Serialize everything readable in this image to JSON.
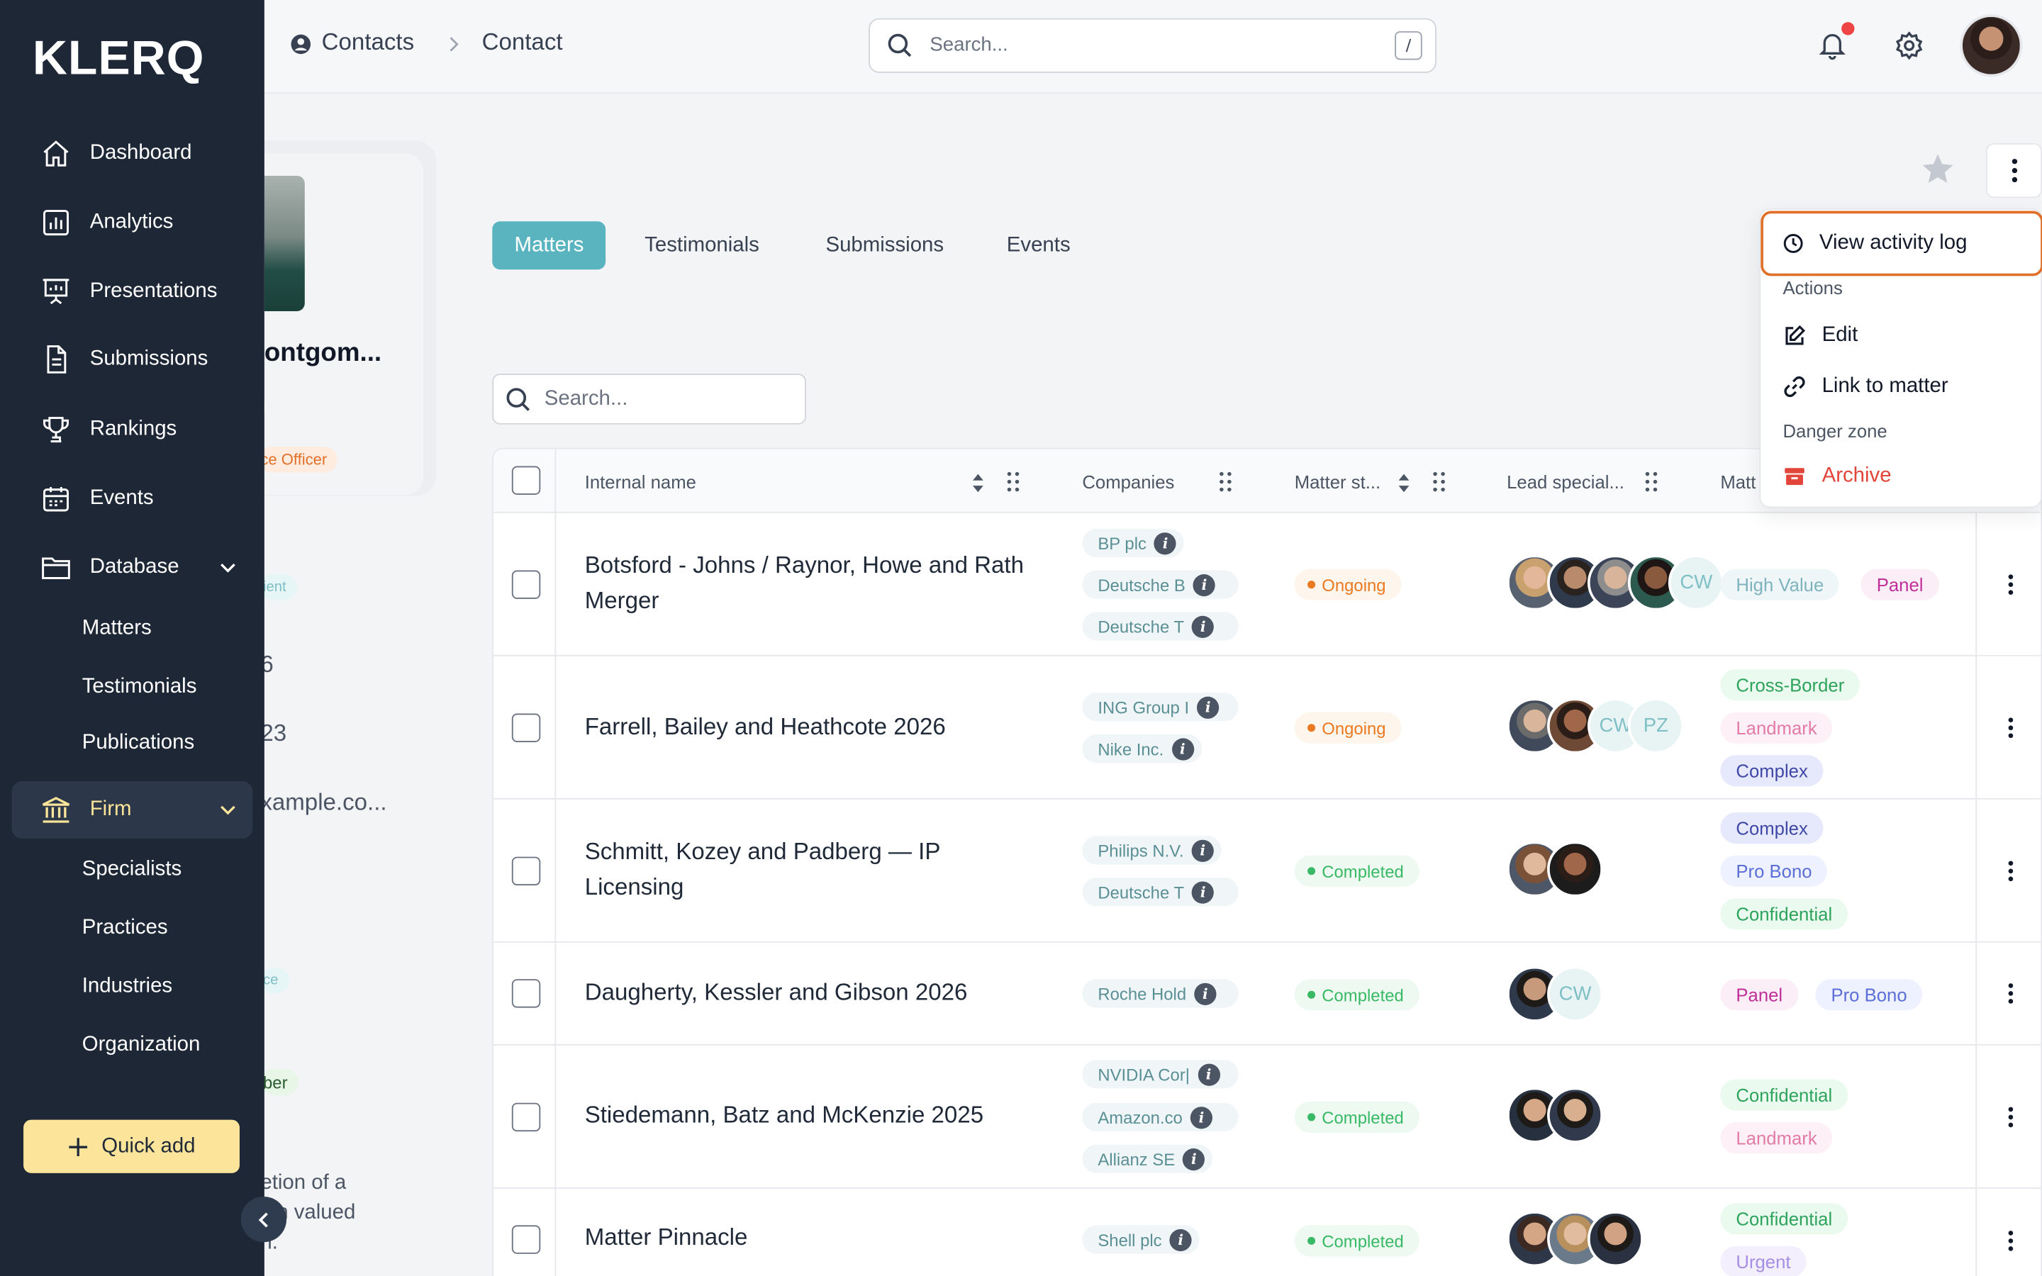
{
  "app": {
    "logo": "KLERQ"
  },
  "sidebar": {
    "items": [
      {
        "label": "Dashboard",
        "icon": "home-icon"
      },
      {
        "label": "Analytics",
        "icon": "analytics-icon"
      },
      {
        "label": "Presentations",
        "icon": "presentation-icon"
      },
      {
        "label": "Submissions",
        "icon": "document-icon"
      },
      {
        "label": "Rankings",
        "icon": "trophy-icon"
      },
      {
        "label": "Events",
        "icon": "calendar-icon"
      },
      {
        "label": "Database",
        "icon": "folder-icon"
      }
    ],
    "database_sub": [
      "Matters",
      "Testimonials",
      "Publications"
    ],
    "firm": {
      "label": "Firm",
      "icon": "bank-icon"
    },
    "firm_sub": [
      "Specialists",
      "Practices",
      "Industries",
      "Organization"
    ],
    "quick_add": "Quick add"
  },
  "header": {
    "breadcrumb": [
      "Contacts",
      "Contact"
    ],
    "search_placeholder": "Search...",
    "search_shortcut": "/"
  },
  "profile": {
    "name_fragment": "ontgom...",
    "role_fragment": "ce Officer",
    "bg_fragments": [
      "ient",
      "6",
      "23",
      "xample.co...",
      "ce",
      "ber",
      "etion of a",
      "ion valued",
      "n."
    ]
  },
  "tabs": [
    "Matters",
    "Testimonials",
    "Submissions",
    "Events"
  ],
  "table_search_placeholder": "Search...",
  "table": {
    "columns": [
      "Internal name",
      "Companies",
      "Matter st...",
      "Lead special...",
      "Matt"
    ],
    "rows": [
      {
        "name": "Botsford - Johns / Raynor, Howe and Rath Merger",
        "companies": [
          "BP plc",
          "Deutsche B",
          "Deutsche T"
        ],
        "status": "Ongoing",
        "avatars": [
          "photo",
          "photo",
          "photo",
          "photo",
          "CW"
        ],
        "tags": [
          "High Value",
          "Panel"
        ]
      },
      {
        "name": "Farrell, Bailey and Heathcote 2026",
        "companies": [
          "ING Group I",
          "Nike Inc."
        ],
        "status": "Ongoing",
        "avatars": [
          "photo",
          "photo",
          "CW",
          "PZ"
        ],
        "tags": [
          "Cross-Border",
          "Landmark",
          "Complex"
        ]
      },
      {
        "name": "Schmitt, Kozey and Padberg — IP Licensing",
        "companies": [
          "Philips N.V.",
          "Deutsche T"
        ],
        "status": "Completed",
        "avatars": [
          "photo",
          "photo"
        ],
        "tags": [
          "Complex",
          "Pro Bono",
          "Confidential"
        ]
      },
      {
        "name": "Daugherty, Kessler and Gibson 2026",
        "companies": [
          "Roche Hold"
        ],
        "status": "Completed",
        "avatars": [
          "photo",
          "CW"
        ],
        "tags": [
          "Panel",
          "Pro Bono"
        ]
      },
      {
        "name": "Stiedemann, Batz and McKenzie 2025",
        "companies": [
          "NVIDIA Cor|",
          "Amazon.co",
          "Allianz SE"
        ],
        "status": "Completed",
        "avatars": [
          "photo",
          "photo"
        ],
        "tags": [
          "Confidential",
          "Landmark"
        ]
      },
      {
        "name": "Matter Pinnacle",
        "companies": [
          "Shell plc"
        ],
        "status": "Completed",
        "avatars": [
          "photo",
          "photo",
          "photo"
        ],
        "tags": [
          "Confidential",
          "Urgent"
        ]
      }
    ]
  },
  "menu": {
    "view_activity": "View activity log",
    "actions_header": "Actions",
    "edit": "Edit",
    "link": "Link to matter",
    "danger_header": "Danger zone",
    "archive": "Archive"
  },
  "colors": {
    "sidebar_bg": "#1e2735",
    "accent_teal": "#5ab4bf",
    "quick_add_bg": "#fce59a",
    "danger": "#e2453a",
    "focus_ring": "#e0702a"
  }
}
